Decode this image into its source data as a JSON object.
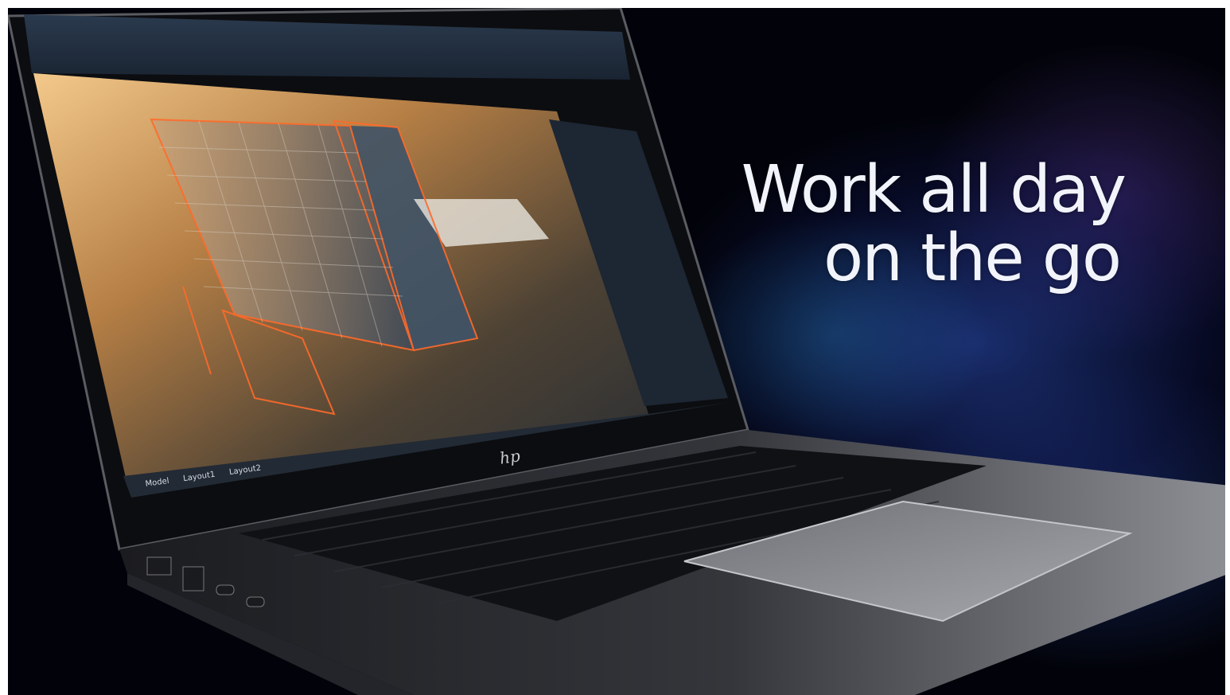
{
  "tagline": {
    "line1": "Work all day",
    "line2": "on the go"
  },
  "laptop": {
    "brand_logo_text": "hp",
    "screen": {
      "tabs": [
        "Model",
        "Layout1",
        "Layout2"
      ]
    }
  },
  "colors": {
    "background": "#02030a",
    "nebula_blue": "#2d50be",
    "laptop_body": "#4a4c52",
    "screen_ribbon": "#1e2a3a",
    "wireframe_orange": "#ff6a2a"
  }
}
